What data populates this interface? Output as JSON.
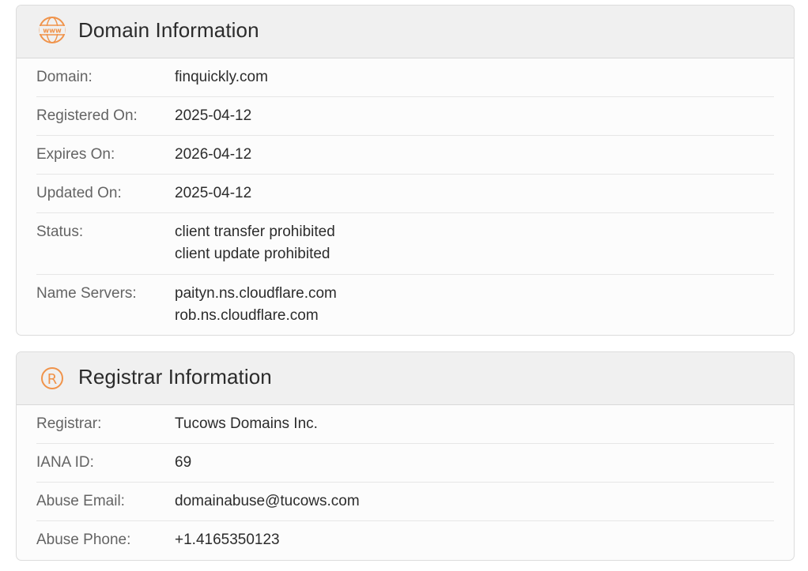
{
  "domain_section": {
    "title": "Domain Information",
    "icon": "www-globe-icon",
    "rows": {
      "domain": {
        "label": "Domain:",
        "value": "finquickly.com"
      },
      "registered": {
        "label": "Registered On:",
        "value": "2025-04-12"
      },
      "expires": {
        "label": "Expires On:",
        "value": "2026-04-12"
      },
      "updated": {
        "label": "Updated On:",
        "value": "2025-04-12"
      },
      "status": {
        "label": "Status:",
        "values": [
          "client transfer prohibited",
          "client update prohibited"
        ]
      },
      "nameservers": {
        "label": "Name Servers:",
        "values": [
          "paityn.ns.cloudflare.com",
          "rob.ns.cloudflare.com"
        ]
      }
    }
  },
  "registrar_section": {
    "title": "Registrar Information",
    "icon": "registered-r-icon",
    "rows": {
      "registrar": {
        "label": "Registrar:",
        "value": "Tucows Domains Inc."
      },
      "iana": {
        "label": "IANA ID:",
        "value": "69"
      },
      "abuse_email": {
        "label": "Abuse Email:",
        "value": "domainabuse@tucows.com"
      },
      "abuse_phone": {
        "label": "Abuse Phone:",
        "value": "+1.4165350123"
      }
    }
  },
  "colors": {
    "accent": "#f0934a",
    "header_bg": "#f0f0f0",
    "card_bg": "#fcfcfc",
    "label": "#646464",
    "value": "#2c2c2c"
  }
}
